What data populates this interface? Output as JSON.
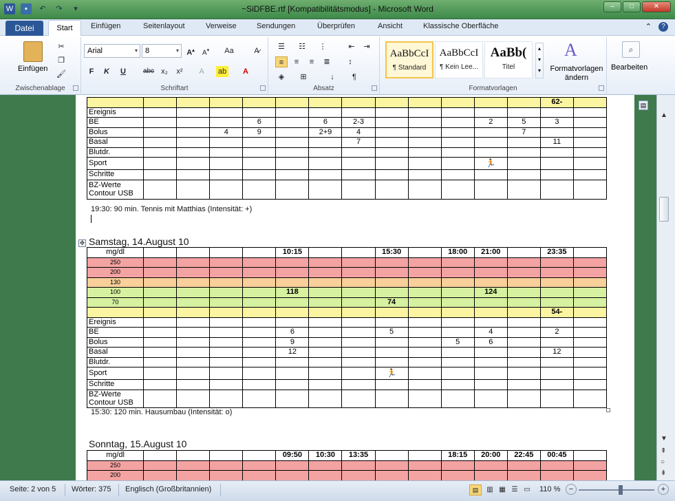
{
  "window": {
    "title": "~SiDFBE.rtf [Kompatibilitätsmodus]  -  Microsoft Word",
    "controls": {
      "minimize": "–",
      "maximize": "□",
      "close": "✕"
    }
  },
  "tabs": {
    "file": "Datei",
    "items": [
      "Start",
      "Einfügen",
      "Seitenlayout",
      "Verweise",
      "Sendungen",
      "Überprüfen",
      "Ansicht",
      "Klassische Oberfläche"
    ]
  },
  "ribbon": {
    "clipboard": {
      "paste": "Einfügen",
      "label": "Zwischenablage"
    },
    "font": {
      "name": "Arial",
      "size": "8",
      "label": "Schriftart",
      "bold": "F",
      "italic": "K",
      "underline": "U",
      "strike": "abc"
    },
    "paragraph": {
      "label": "Absatz"
    },
    "styles": {
      "label": "Formatvorlagen",
      "items": [
        {
          "sample": "AaBbCcI",
          "name": "¶ Standard"
        },
        {
          "sample": "AaBbCcI",
          "name": "¶ Kein Lee..."
        },
        {
          "sample": "AaBb(",
          "name": "Titel"
        }
      ],
      "change": "Formatvorlagen ändern"
    },
    "edit": {
      "label": "Bearbeiten"
    }
  },
  "doc": {
    "table1": {
      "partial_value": "62-",
      "rows": {
        "Ereignis": [
          "",
          "",
          "",
          "",
          "",
          "",
          "",
          "",
          "",
          "",
          "",
          "",
          "",
          ""
        ],
        "BE": [
          "",
          "",
          "",
          "6",
          "",
          "6",
          "2-3",
          "",
          "",
          "",
          "2",
          "5",
          "3",
          ""
        ],
        "Bolus": [
          "",
          "",
          "4",
          "9",
          "",
          "2+9",
          "4",
          "",
          "",
          "",
          "",
          "7",
          "",
          ""
        ],
        "Basal": [
          "",
          "",
          "",
          "",
          "",
          "",
          "7",
          "",
          "",
          "",
          "",
          "",
          "11",
          ""
        ],
        "Blutdr.": [],
        "Sport": [],
        "Schritte": [],
        "BZ-Werte": []
      },
      "labels": [
        "Ereignis",
        "BE",
        "Bolus",
        "Basal",
        "Blutdr.",
        "Sport",
        " Schritte",
        " BZ-Werte Contour USB"
      ],
      "note": "19:30: 90 min. Tennis mit Matthias (Intensität: +)"
    },
    "day2": {
      "heading": "Samstag, 14.August  10",
      "header_label": "mg/dl",
      "times": [
        "",
        "",
        "",
        "",
        "10:15",
        "",
        "",
        "15:30",
        "",
        "18:00",
        "21:00",
        "",
        "23:35",
        ""
      ],
      "levels": [
        "250",
        "200",
        "130",
        "100",
        "70"
      ],
      "bz_values": {
        "100": {
          "col": 5,
          "val": "118"
        },
        "100b": {
          "col": 11,
          "val": "124"
        },
        "70": {
          "col": 8,
          "val": "74"
        },
        "low": "54-"
      },
      "BE": [
        "",
        "",
        "",
        "",
        "6",
        "",
        "",
        "5",
        "",
        "",
        "4",
        "",
        "2",
        ""
      ],
      "Bolus": [
        "",
        "",
        "",
        "",
        "9",
        "",
        "",
        "",
        "",
        "5",
        "6",
        "",
        "",
        ""
      ],
      "Basal": [
        "",
        "",
        "",
        "",
        "12",
        "",
        "",
        "",
        "",
        "",
        "",
        "",
        "12",
        ""
      ],
      "note": "15:30: 120 min. Hausumbau (Intensität: o)"
    },
    "day3": {
      "heading": "Sonntag, 15.August  10",
      "header_label": "mg/dl",
      "times": [
        "",
        "",
        "",
        "",
        "09:50",
        "10:30",
        "13:35",
        "",
        "",
        "18:15",
        "20:00",
        "22:45",
        "00:45",
        ""
      ],
      "levels": [
        "250",
        "200"
      ]
    }
  },
  "status": {
    "page": "Seite: 2 von 5",
    "words": "Wörter: 375",
    "language": "Englisch (Großbritannien)",
    "zoom": "110 %",
    "zoom_minus": "−",
    "zoom_plus": "+"
  },
  "colors": {
    "red_band": "#f4a3a3",
    "orange_band": "#f9cf9a",
    "green_band": "#d6f1a0",
    "yellow_band": "#fbf4a0",
    "file_tab": "#2b5797"
  }
}
